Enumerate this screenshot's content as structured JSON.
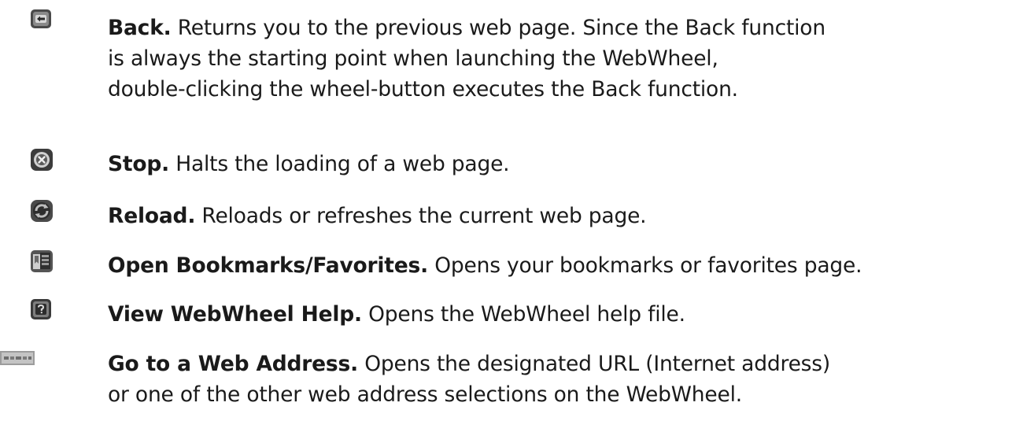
{
  "functions": [
    {
      "icon": "back-arrow-icon",
      "term": "Back.",
      "lines": [
        "Returns you to the previous web page. Since the Back function",
        "is always the starting point when launching the WebWheel,",
        "double-clicking the wheel-button executes the Back function."
      ]
    },
    {
      "icon": "stop-x-icon",
      "term": "Stop.",
      "lines": [
        "Halts the loading of a web page."
      ]
    },
    {
      "icon": "reload-circular-icon",
      "term": "Reload.",
      "lines": [
        "Reloads or refreshes the current web page."
      ]
    },
    {
      "icon": "bookmarks-folder-icon",
      "term": "Open Bookmarks/Favorites.",
      "lines": [
        "Opens your bookmarks or favorites page."
      ]
    },
    {
      "icon": "help-question-icon",
      "term": "View WebWheel Help.",
      "lines": [
        "Opens the WebWheel help file."
      ]
    },
    {
      "icon": "web-address-bar-icon",
      "term": "Go to a Web Address.",
      "lines": [
        "Opens the designated URL (Internet address)",
        "or one of the other web address selections on the WebWheel."
      ]
    }
  ]
}
